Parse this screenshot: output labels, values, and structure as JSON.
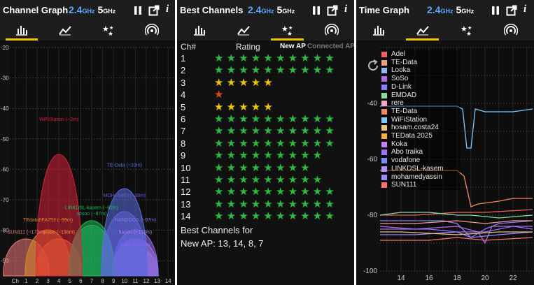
{
  "channel_graph": {
    "title": "Channel Graph",
    "band_24": "2.4",
    "band_24_unit": "GHz",
    "band_5": "5",
    "band_5_unit": "GHz",
    "y_ticks": [
      "-20",
      "-30",
      "-40",
      "-50",
      "-60",
      "-70",
      "-80",
      "-90"
    ],
    "x_ticks": [
      "Ch",
      "1",
      "2",
      "3",
      "4",
      "5",
      "6",
      "7",
      "8",
      "9",
      "10",
      "11",
      "12",
      "13",
      "14"
    ],
    "networks": [
      {
        "label": "WiFiStation (~2m)",
        "channel": 4,
        "signal": -45,
        "color": "#d8233c"
      },
      {
        "label": "TE-Data (~10m)",
        "channel": 10,
        "signal": -60,
        "color": "#5a6fe0"
      },
      {
        "label": "MOHAMED (~39m)",
        "channel": 10,
        "signal": -70,
        "color": "#6a55d8"
      },
      {
        "label": "LINKDSL-kasem (~62m)",
        "channel": 7,
        "signal": -74,
        "color": "#1fbe5a"
      },
      {
        "label": "sosoo (~87m)",
        "channel": 7,
        "signal": -76,
        "color": "#25a867"
      },
      {
        "label": "TEdata0FA753 (~99m)",
        "channel": 3,
        "signal": -78,
        "color": "#e08a2a"
      },
      {
        "label": "RANDDOS (~97m)",
        "channel": 11,
        "signal": -78,
        "color": "#9070e8"
      },
      {
        "label": "SUN111 (~173m)",
        "channel": 1,
        "signal": -82,
        "color": "#f07b7b"
      },
      {
        "label": "stabo (~156m)",
        "channel": 4,
        "signal": -82,
        "color": "#ff8a2a"
      },
      {
        "label": "haoon (~173m)",
        "channel": 11,
        "signal": -82,
        "color": "#b07ae8"
      },
      {
        "label": "Koke (~243m)",
        "channel": 11,
        "signal": -86,
        "color": "#8f63ff"
      }
    ]
  },
  "best_channels": {
    "title": "Best Channels",
    "col_channel": "Ch#",
    "col_rating": "Rating",
    "tab_new_ap": "New AP",
    "tab_connected_ap": "Connected AP",
    "ratings": [
      {
        "ch": "1",
        "stars": 10,
        "color": "#2dbb3f"
      },
      {
        "ch": "2",
        "stars": 10,
        "color": "#2dbb3f"
      },
      {
        "ch": "3",
        "stars": 5,
        "color": "#f2c400"
      },
      {
        "ch": "4",
        "stars": 1,
        "color": "#e6452a"
      },
      {
        "ch": "5",
        "stars": 5,
        "color": "#f2c400"
      },
      {
        "ch": "6",
        "stars": 10,
        "color": "#2dbb3f"
      },
      {
        "ch": "7",
        "stars": 10,
        "color": "#2dbb3f"
      },
      {
        "ch": "8",
        "stars": 10,
        "color": "#2dbb3f"
      },
      {
        "ch": "9",
        "stars": 9,
        "color": "#2dbb3f"
      },
      {
        "ch": "10",
        "stars": 8,
        "color": "#2dbb3f"
      },
      {
        "ch": "11",
        "stars": 9,
        "color": "#2dbb3f"
      },
      {
        "ch": "12",
        "stars": 10,
        "color": "#2dbb3f"
      },
      {
        "ch": "13",
        "stars": 10,
        "color": "#2dbb3f"
      },
      {
        "ch": "14",
        "stars": 10,
        "color": "#2dbb3f"
      }
    ],
    "summary_line1": "Best Channels for",
    "summary_line2": "New AP: 13, 14, 8, 7"
  },
  "time_graph": {
    "title": "Time Graph",
    "y_ticks": [
      "-40",
      "-60",
      "-80",
      "-100"
    ],
    "x_ticks": [
      "14",
      "16",
      "18",
      "20",
      "22"
    ],
    "legend": [
      {
        "name": "Adel",
        "color": "#f06060"
      },
      {
        "name": "TE-Data",
        "color": "#f0a080"
      },
      {
        "name": "Looka",
        "color": "#8fb8ff"
      },
      {
        "name": "SoSo",
        "color": "#b06ae0"
      },
      {
        "name": "D-Link",
        "color": "#8a7aff"
      },
      {
        "name": "EMDAD",
        "color": "#80e0a0"
      },
      {
        "name": "rere",
        "color": "#f0a8c0"
      },
      {
        "name": "TE-Data",
        "color": "#f08a60"
      },
      {
        "name": "WiFiStation",
        "color": "#80c8ff"
      },
      {
        "name": "hosam.costa24",
        "color": "#f0c080"
      },
      {
        "name": "TEData 2025",
        "color": "#ffb040"
      },
      {
        "name": "Koka",
        "color": "#c080ff"
      },
      {
        "name": "Abo traika",
        "color": "#a070ff"
      },
      {
        "name": "vodafone",
        "color": "#7a8aff"
      },
      {
        "name": "LINKDSL-kasem",
        "color": "#b090ff"
      },
      {
        "name": "mohamedyassin",
        "color": "#9a8aff"
      },
      {
        "name": "SUN111",
        "color": "#ff7070"
      }
    ]
  },
  "colors": {
    "accent": "#f2c400",
    "band": "#5ea9ff"
  },
  "icons": [
    "pause-icon",
    "open-external-icon",
    "info-icon",
    "bar-chart-icon",
    "line-chart-icon",
    "stars-icon",
    "access-point-icon",
    "refresh-icon"
  ]
}
